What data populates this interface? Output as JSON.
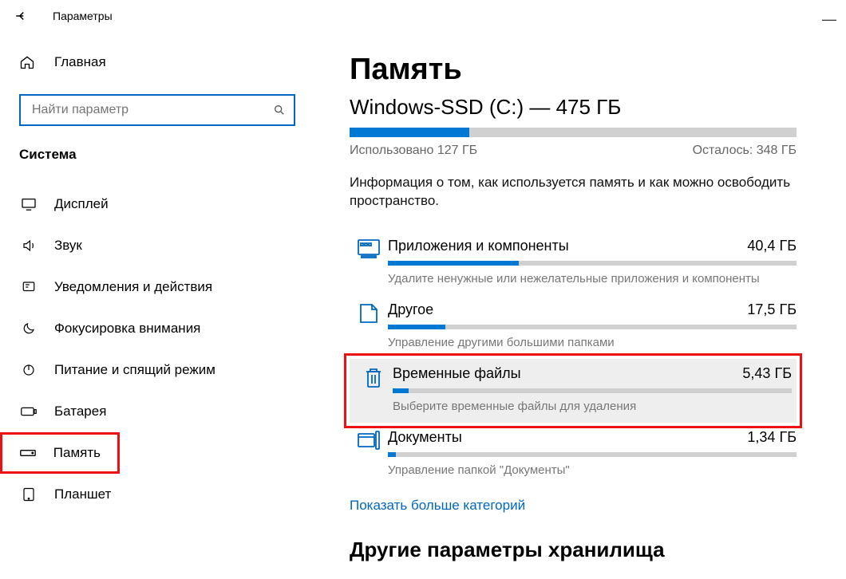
{
  "titlebar": {
    "title": "Параметры"
  },
  "sidebar": {
    "home": "Главная",
    "search_placeholder": "Найти параметр",
    "category": "Система",
    "items": [
      {
        "label": "Дисплей"
      },
      {
        "label": "Звук"
      },
      {
        "label": "Уведомления и действия"
      },
      {
        "label": "Фокусировка внимания"
      },
      {
        "label": "Питание и спящий режим"
      },
      {
        "label": "Батарея"
      },
      {
        "label": "Память"
      },
      {
        "label": "Планшет"
      }
    ]
  },
  "main": {
    "title": "Память",
    "drive": "Windows-SSD (C:) — 475 ГБ",
    "used_label": "Использовано 127 ГБ",
    "free_label": "Осталось: 348 ГБ",
    "blurb": "Информация о том, как используется память и как можно освободить пространство.",
    "cats": [
      {
        "title": "Приложения и компоненты",
        "size": "40,4 ГБ",
        "desc": "Удалите ненужные или нежелательные приложения и компоненты",
        "fill_pct": 32
      },
      {
        "title": "Другое",
        "size": "17,5 ГБ",
        "desc": "Управление другими большими папками",
        "fill_pct": 14
      },
      {
        "title": "Временные файлы",
        "size": "5,43 ГБ",
        "desc": "Выберите временные файлы для удаления",
        "fill_pct": 4
      },
      {
        "title": "Документы",
        "size": "1,34 ГБ",
        "desc": "Управление папкой \"Документы\"",
        "fill_pct": 2
      }
    ],
    "more": "Показать больше категорий",
    "next_h": "Другие параметры хранилища"
  },
  "chart_data": {
    "type": "bar",
    "title": "Windows-SSD (C:) — 475 ГБ",
    "total_gb": 475,
    "used_gb": 127,
    "free_gb": 348,
    "categories": [
      "Приложения и компоненты",
      "Другое",
      "Временные файлы",
      "Документы"
    ],
    "values_gb": [
      40.4,
      17.5,
      5.43,
      1.34
    ]
  }
}
